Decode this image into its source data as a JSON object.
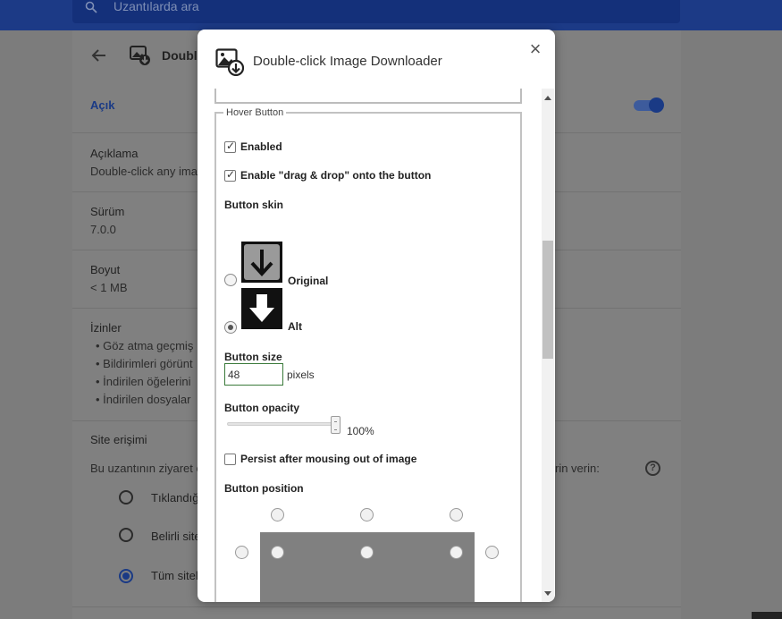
{
  "background": {
    "search_placeholder": "Uzantılarda ara",
    "extension_title": "Double",
    "on_label": "Açık",
    "description_label": "Açıklama",
    "description_value": "Double-click any ima",
    "version_label": "Sürüm",
    "version_value": "7.0.0",
    "size_label": "Boyut",
    "size_value": "< 1 MB",
    "permissions_label": "İzinler",
    "permissions": [
      "Göz atma geçmiş",
      "Bildirimleri görünt",
      "İndirilen öğelerini",
      "İndirilen dosyalar"
    ],
    "site_access_label": "Site erişimi",
    "site_access_text": "Bu uzantının ziyaret e",
    "site_access_text_end": "rin verin:",
    "site_access_options": [
      "Tıklandığ",
      "Belirli site",
      "Tüm sitel"
    ],
    "site_access_selected": 2,
    "toggle_on": true,
    "accent_color": "#1a3a85"
  },
  "dialog": {
    "title": "Double-click Image Downloader",
    "close_icon": "close-icon",
    "hover_button": {
      "legend": "Hover Button",
      "enabled_label": "Enabled",
      "enabled_checked": true,
      "drag_drop_label": "Enable \"drag & drop\" onto the button",
      "drag_drop_checked": true,
      "skin_label": "Button skin",
      "skins": [
        {
          "label": "Original",
          "selected": false
        },
        {
          "label": "Alt",
          "selected": true
        }
      ],
      "size_label": "Button size",
      "size_value": "48",
      "size_unit": "pixels",
      "opacity_label": "Button opacity",
      "opacity_value": "100%",
      "opacity_fraction": 1.0,
      "persist_label": "Persist after mousing out of image",
      "persist_checked": false,
      "position_label": "Button position",
      "position_selected": "row-3-right-outside"
    }
  }
}
